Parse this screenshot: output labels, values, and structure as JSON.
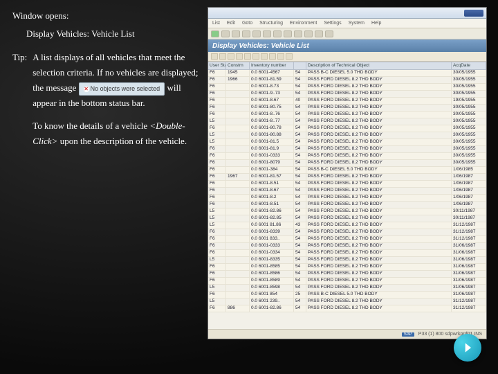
{
  "left": {
    "window_opens": "Window opens:",
    "window_title": "Display Vehicles: Vehicle List",
    "tip_label": "Tip:",
    "tip_line1": "A list displays of all vehicles that meet the selection criteria.  If no vehicles are displayed; the message",
    "status_msg": "No objects were selected",
    "tip_line1b": "will appear in the bottom status bar.",
    "tip_line2a": "To know the details of a vehicle",
    "tip_line2b": "<Double-Click>",
    "tip_line2c": "upon the description of the vehicle."
  },
  "ss": {
    "menu": [
      "List",
      "Edit",
      "Goto",
      "Structuring",
      "Environment",
      "Settings",
      "System",
      "Help"
    ],
    "header": "Display Vehicles: Vehicle List",
    "columns": [
      "User Status",
      "Constrn",
      "Inventory number",
      "",
      "Description of Technical Object",
      "AcqDate"
    ],
    "rows": [
      {
        "c1": "F6",
        "c2": "1945",
        "c3": "0.0 6001-4567",
        "c4": "54",
        "c5": "PASS B-C DIESEL 5.0 THD BODY",
        "c6": "30/05/1955"
      },
      {
        "c1": "F6",
        "c2": "1966",
        "c3": "0.0 6001-81.59",
        "c4": "54",
        "c5": "PASS FORD DIESEL 8.2 THD BODY",
        "c6": "30/05/1955"
      },
      {
        "c1": "F6",
        "c2": "",
        "c3": "0.0 6001-8.73",
        "c4": "54",
        "c5": "PASS FORD DIESEL 8.2 THD BODY",
        "c6": "30/05/1955"
      },
      {
        "c1": "F6",
        "c2": "",
        "c3": "0.0 6001-9..73",
        "c4": "54",
        "c5": "PASS FORD DIESEL 8.2 THD BODY",
        "c6": "30/05/1955"
      },
      {
        "c1": "F6",
        "c2": "",
        "c3": "0.0 6001-8.67",
        "c4": "40",
        "c5": "PASS FORD DIESEL 8.2 THD BODY",
        "c6": "19/05/1955"
      },
      {
        "c1": "F6",
        "c2": "",
        "c3": "0.0 6001-80.75",
        "c4": "54",
        "c5": "PASS FORD DIESEL 8.2 THD BODY",
        "c6": "30/05/1955"
      },
      {
        "c1": "F6",
        "c2": "",
        "c3": "0.0 6001-8..76",
        "c4": "54",
        "c5": "PASS FORD DIESEL 8.2 THD BODY",
        "c6": "30/05/1955"
      },
      {
        "c1": "L5",
        "c2": "",
        "c3": "0.0 6001-8..77",
        "c4": "54",
        "c5": "PASS FORD DIESEL 8.2 THD BODY",
        "c6": "30/05/1955"
      },
      {
        "c1": "F6",
        "c2": "",
        "c3": "0.0 6001-80.78",
        "c4": "54",
        "c5": "PASS FORD DIESEL 8.2 THD BODY",
        "c6": "30/05/1955"
      },
      {
        "c1": "L5",
        "c2": "",
        "c3": "0.0 6001-80.88",
        "c4": "54",
        "c5": "PASS FORD DIESEL 8.2 THD BODY",
        "c6": "30/05/1955"
      },
      {
        "c1": "L5",
        "c2": "",
        "c3": "0.0 6001-81.5",
        "c4": "54",
        "c5": "PASS FORD DIESEL 8.2 THD BODY",
        "c6": "30/05/1955"
      },
      {
        "c1": "F6",
        "c2": "",
        "c3": "0.0 6001-81.9",
        "c4": "54",
        "c5": "PASS FORD DIESEL 8.2 THD BODY",
        "c6": "30/05/1955"
      },
      {
        "c1": "F6",
        "c2": "",
        "c3": "0.0 6001-0333",
        "c4": "54",
        "c5": "PASS FORD DIESEL 8.2 THD BODY",
        "c6": "30/05/1955"
      },
      {
        "c1": "F6",
        "c2": "",
        "c3": "0.0 6001-8079",
        "c4": "54",
        "c5": "PASS FORD DIESEL 8.2 THD BODY",
        "c6": "30/05/1955"
      },
      {
        "c1": "F6",
        "c2": "",
        "c3": "0.0 6001-384",
        "c4": "54",
        "c5": "PASS B-C DIESEL 5.0 THD BODY",
        "c6": "1/06/1985"
      },
      {
        "c1": "F6",
        "c2": "1967",
        "c3": "0.0 6001-81.57",
        "c4": "54",
        "c5": "PASS FORD DIESEL 8.2 THD BODY",
        "c6": "1/06/1987"
      },
      {
        "c1": "F6",
        "c2": "",
        "c3": "0.0 6001-8.51",
        "c4": "54",
        "c5": "PASS FORD DIESEL 8.2 THD BODY",
        "c6": "1/06/1987"
      },
      {
        "c1": "F6",
        "c2": "",
        "c3": "0.0 6001-8.67",
        "c4": "54",
        "c5": "PASS FORD DIESEL 8.2 THD BODY",
        "c6": "1/06/1987"
      },
      {
        "c1": "F6",
        "c2": "",
        "c3": "0.0 6001-8.2",
        "c4": "54",
        "c5": "PASS FORD DIESEL 8.2 THD BODY",
        "c6": "1/06/1987"
      },
      {
        "c1": "F6",
        "c2": "",
        "c3": "0.0 6001-8.51",
        "c4": "54",
        "c5": "PASS FORD DIESEL 8.2 THD BODY",
        "c6": "1/06/1987"
      },
      {
        "c1": "L5",
        "c2": "",
        "c3": "0.0 6001-82.86",
        "c4": "54",
        "c5": "PASS FORD DIESEL 8.2 THD BODY",
        "c6": "30/11/1987"
      },
      {
        "c1": "L5",
        "c2": "",
        "c3": "0.0 6001-82.85",
        "c4": "54",
        "c5": "PASS FORD DIESEL 8.2 THD BODY",
        "c6": "30/11/1987"
      },
      {
        "c1": "L5",
        "c2": "",
        "c3": "0.0 6001 81.86",
        "c4": "43",
        "c5": "PASS FORD DIESEL 8.2 THD BODY",
        "c6": "31/12/1987"
      },
      {
        "c1": "F6",
        "c2": "",
        "c3": "0.0 6001-8339",
        "c4": "54",
        "c5": "PASS FORD DIESEL 8.2 THD BODY",
        "c6": "31/12/1987"
      },
      {
        "c1": "F6",
        "c2": "",
        "c3": "0.0 6001 833..",
        "c4": "54",
        "c5": "PASS FORD DIESEL 8.2 THD BODY",
        "c6": "31/12/1987"
      },
      {
        "c1": "F6",
        "c2": "",
        "c3": "0.0 6001-0333",
        "c4": "54",
        "c5": "PASS FORD DIESEL 8.2 THD BODY",
        "c6": "31/06/1987"
      },
      {
        "c1": "F6",
        "c2": "",
        "c3": "0.0 6001-0334",
        "c4": "54",
        "c5": "PASS FORD DIESEL 8.2 THD BODY",
        "c6": "31/06/1987"
      },
      {
        "c1": "L5",
        "c2": "",
        "c3": "0.0 6001-8335",
        "c4": "54",
        "c5": "PASS FORD DIESEL 8.2 THD BODY",
        "c6": "31/06/1987"
      },
      {
        "c1": "F6",
        "c2": "",
        "c3": "0.0 6001-8585",
        "c4": "54",
        "c5": "PASS FORD DIESEL 8.2 THD BODY",
        "c6": "31/06/1987"
      },
      {
        "c1": "F6",
        "c2": "",
        "c3": "0.0 6001-8586",
        "c4": "54",
        "c5": "PASS FORD DIESEL 8.2 THD BODY",
        "c6": "31/06/1987"
      },
      {
        "c1": "F6",
        "c2": "",
        "c3": "0.0 6001-8589",
        "c4": "54",
        "c5": "PASS FORD DIESEL 8.2 THD BODY",
        "c6": "31/06/1987"
      },
      {
        "c1": "L5",
        "c2": "",
        "c3": "0.0 6001-8598",
        "c4": "54",
        "c5": "PASS FORD DIESEL 8.2 THD BODY",
        "c6": "31/06/1987"
      },
      {
        "c1": "F6",
        "c2": "",
        "c3": "0.0 6001 854",
        "c4": "25",
        "c5": "PASS B-C DIESEL 5.0 THD BODY",
        "c6": "31/06/1987"
      },
      {
        "c1": "L5",
        "c2": "",
        "c3": "0.0 6001 239..",
        "c4": "54",
        "c5": "PASS FORD DIESEL 8.2 THD BODY",
        "c6": "31/12/1987"
      },
      {
        "c1": "F6",
        "c2": "886",
        "c3": "0.0 6001-82.86",
        "c4": "54",
        "c5": "PASS FORD DIESEL 8.2 THD BODY",
        "c6": "31/12/1987"
      }
    ],
    "status": {
      "sap": "SAP",
      "right": "P33 (1) 800   sdpwrkprd01   INS"
    }
  }
}
